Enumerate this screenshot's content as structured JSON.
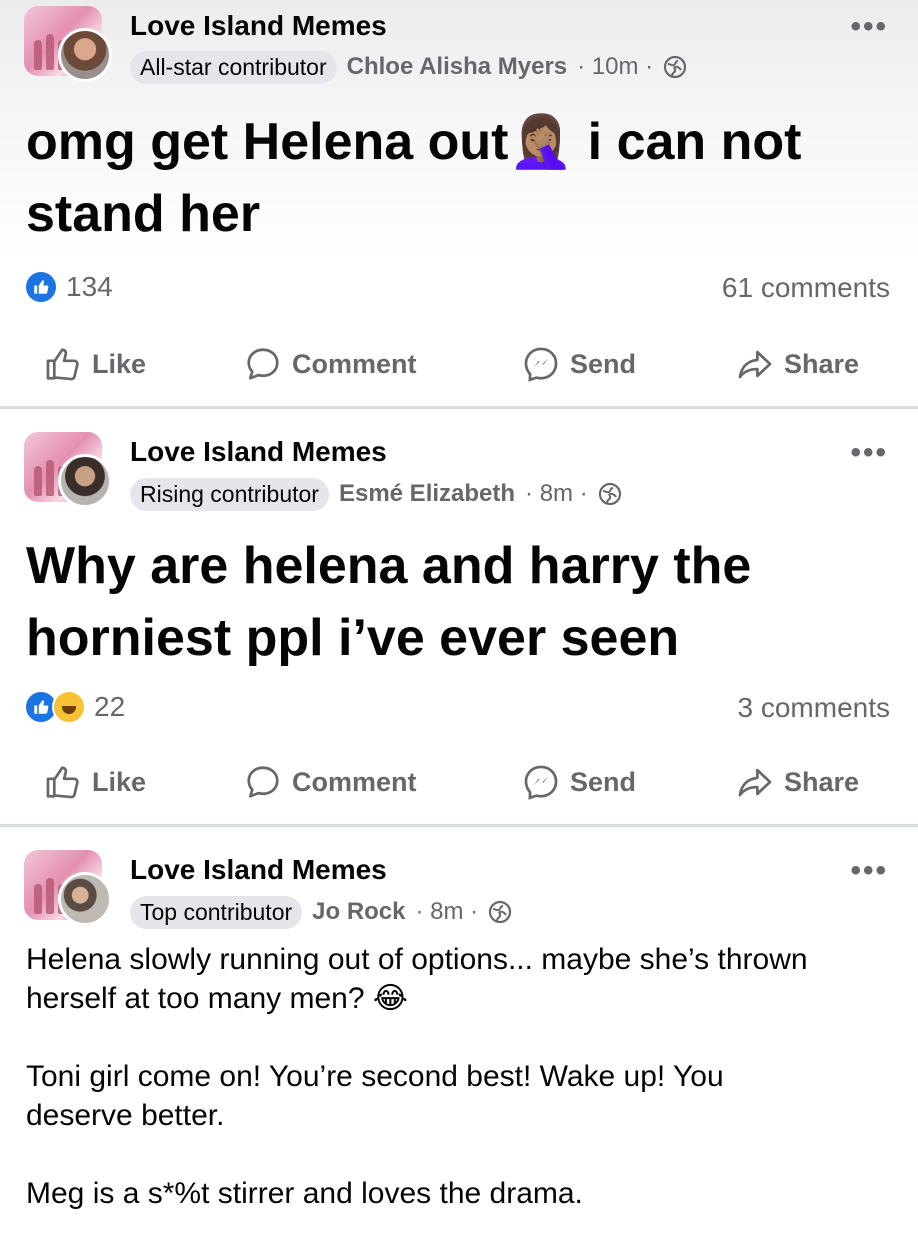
{
  "colors": {
    "accent": "#1b74e4",
    "text": "#050505",
    "secondary": "#65676b",
    "badge_bg": "#e4e6eb",
    "divider": "#dadde1"
  },
  "icons": {
    "more": "more-horizontal-icon",
    "audience": "globe-icon",
    "like": "thumbs-up-icon",
    "comment": "speech-bubble-icon",
    "send": "messenger-icon",
    "share": "share-arrow-icon"
  },
  "posts": [
    {
      "group": "Love Island Memes",
      "badge": "All-star contributor",
      "author": "Chloe Alisha Myers",
      "time": "· 10m ·",
      "text_line1": "omg get Helena out",
      "text_emoji": "🤦🏽‍♀️",
      "text_line1b": " i can not",
      "text_line2": "stand her",
      "reaction_count": "134",
      "comments": "61 comments",
      "actions": {
        "like": "Like",
        "comment": "Comment",
        "send": "Send",
        "share": "Share"
      }
    },
    {
      "group": "Love Island Memes",
      "badge": "Rising contributor",
      "author": "Esmé Elizabeth",
      "time": "· 8m ·",
      "text_line1": "Why are helena and harry the",
      "text_line2": "horniest ppl i’ve ever seen",
      "reaction_count": "22",
      "comments": "3 comments",
      "actions": {
        "like": "Like",
        "comment": "Comment",
        "send": "Send",
        "share": "Share"
      }
    },
    {
      "group": "Love Island Memes",
      "badge": "Top contributor",
      "author": "Jo Rock",
      "time": "· 8m ·",
      "para1_line1": "Helena slowly running out of options... maybe she’s thrown",
      "para1_line2": "herself at too many men?",
      "para1_emoji": "😂",
      "para2_line1": "Toni girl come on! You’re second best! Wake up! You",
      "para2_line2": "deserve better.",
      "para3_line1": "Meg is a s*%t stirrer and loves the drama."
    }
  ]
}
